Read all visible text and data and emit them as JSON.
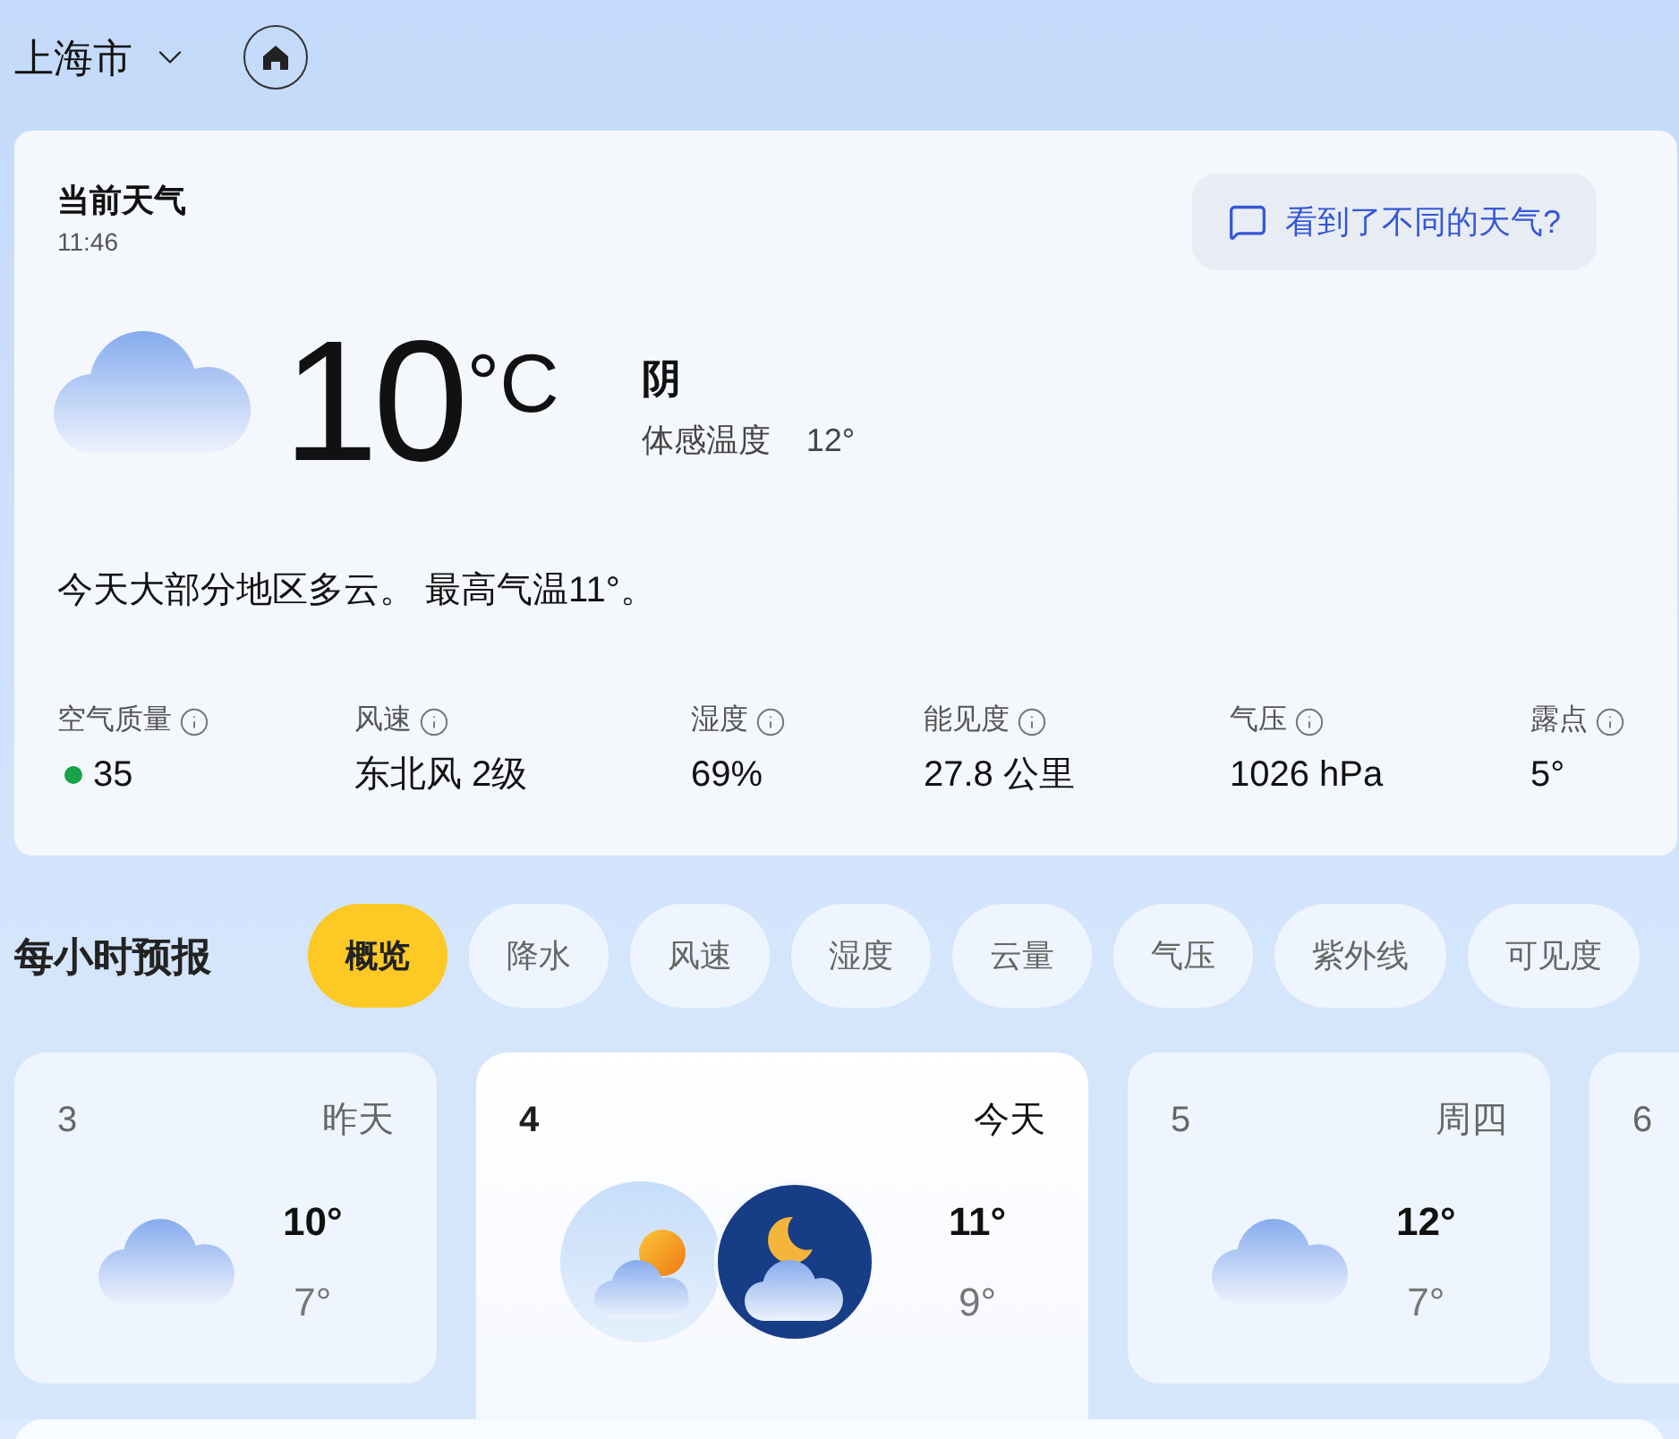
{
  "location": {
    "city": "上海市"
  },
  "current": {
    "title": "当前天气",
    "time": "11:46",
    "feedback": "看到了不同的天气?",
    "temperature": "10",
    "unit": "°C",
    "condition": "阴",
    "feels_like_label": "体感温度",
    "feels_like": "12°",
    "summary": "今天大部分地区多云。 最高气温11°。"
  },
  "details": [
    {
      "label": "空气质量",
      "value": "35",
      "color": "#16a34a"
    },
    {
      "label": "风速",
      "value": "东北风 2级"
    },
    {
      "label": "湿度",
      "value": "69%"
    },
    {
      "label": "能见度",
      "value": "27.8 公里"
    },
    {
      "label": "气压",
      "value": "1026 hPa"
    },
    {
      "label": "露点",
      "value": "5°"
    }
  ],
  "hourly": {
    "title": "每小时预报",
    "tabs": [
      {
        "label": "概览",
        "selected": true
      },
      {
        "label": "降水",
        "selected": false
      },
      {
        "label": "风速",
        "selected": false
      },
      {
        "label": "湿度",
        "selected": false
      },
      {
        "label": "云量",
        "selected": false
      },
      {
        "label": "气压",
        "selected": false
      },
      {
        "label": "紫外线",
        "selected": false
      },
      {
        "label": "可见度",
        "selected": false
      }
    ],
    "cards": [
      {
        "date": "3",
        "day": "昨天",
        "high": "10°",
        "low": "7°",
        "selected": false
      },
      {
        "date": "4",
        "day": "今天",
        "high": "11°",
        "low": "9°",
        "selected": true
      },
      {
        "date": "5",
        "day": "周四",
        "high": "12°",
        "low": "7°",
        "selected": false
      },
      {
        "date": "6",
        "selected": false
      }
    ]
  }
}
